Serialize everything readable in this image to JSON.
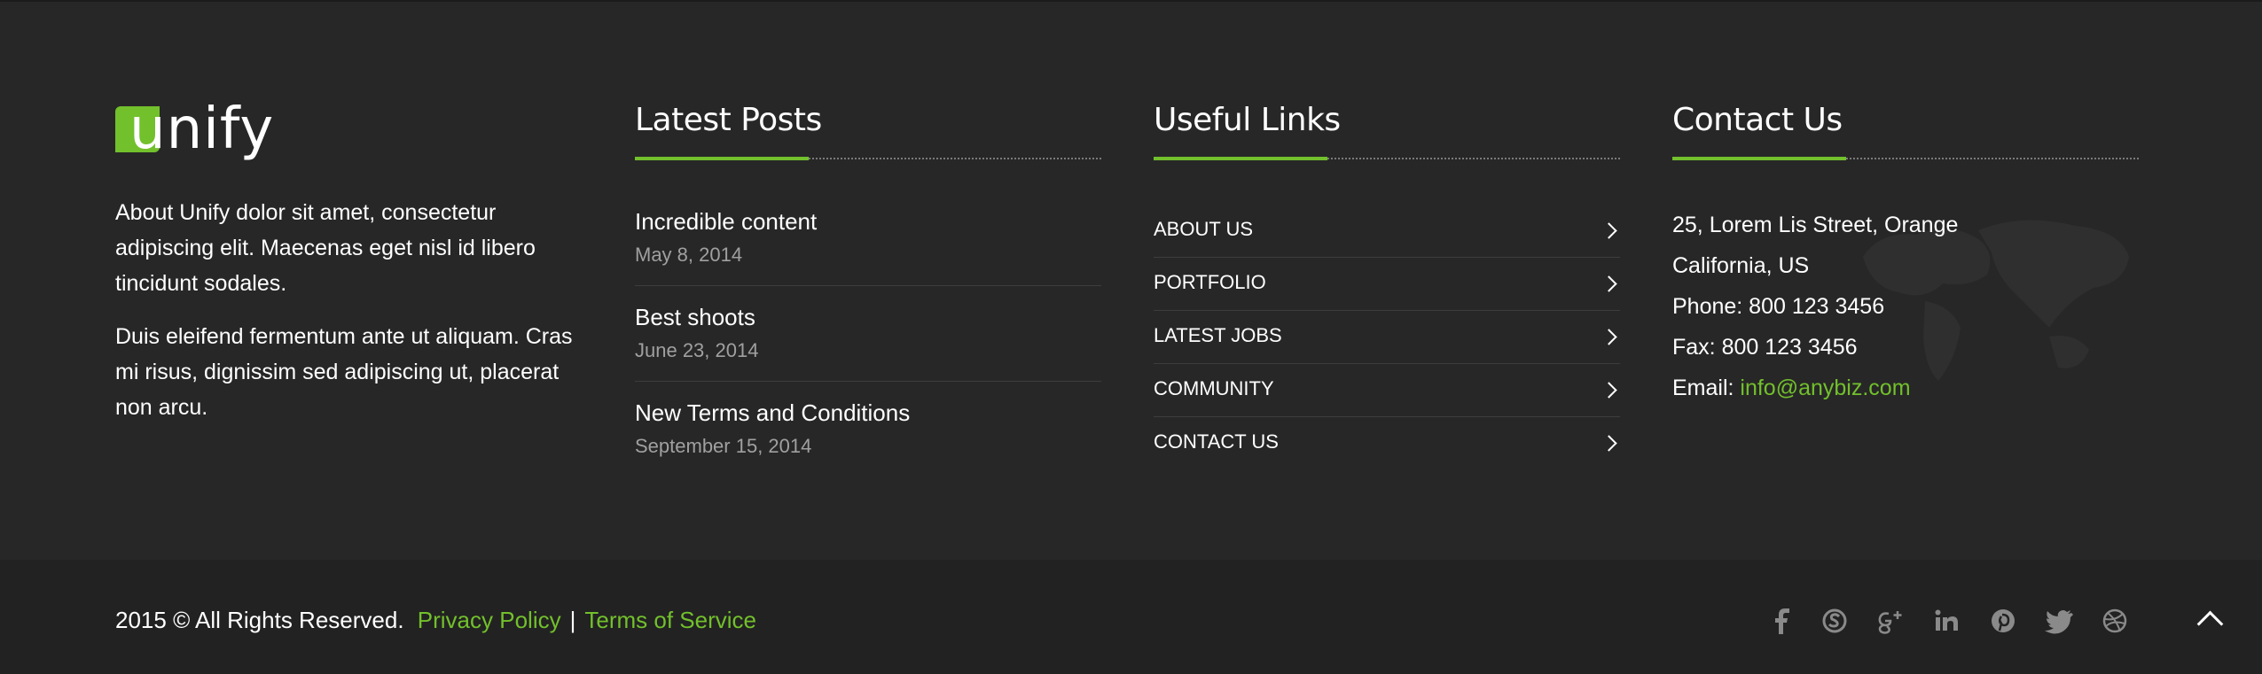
{
  "brand": {
    "logo_text": "unify",
    "accent_color": "#72c02c"
  },
  "about": {
    "paragraph_1": "About Unify dolor sit amet, consectetur adipiscing elit. Maecenas eget nisl id libero tincidunt sodales.",
    "paragraph_2": "Duis eleifend fermentum ante ut aliquam. Cras mi risus, dignissim sed adipiscing ut, placerat non arcu."
  },
  "latest_posts": {
    "heading": "Latest Posts",
    "items": [
      {
        "title": "Incredible content",
        "date": "May 8, 2014"
      },
      {
        "title": "Best shoots",
        "date": "June 23, 2014"
      },
      {
        "title": "New Terms and Conditions",
        "date": "September 15, 2014"
      }
    ]
  },
  "useful_links": {
    "heading": "Useful Links",
    "items": [
      {
        "label": "ABOUT US"
      },
      {
        "label": "PORTFOLIO"
      },
      {
        "label": "LATEST JOBS"
      },
      {
        "label": "COMMUNITY"
      },
      {
        "label": "CONTACT US"
      }
    ]
  },
  "contact": {
    "heading": "Contact Us",
    "address_line_1": "25, Lorem Lis Street, Orange",
    "address_line_2": "California, US",
    "phone": "Phone: 800 123 3456",
    "fax": "Fax: 800 123 3456",
    "email_label": "Email: ",
    "email": "info@anybiz.com"
  },
  "bottom_bar": {
    "copyright": "2015 © All Rights Reserved.",
    "privacy_policy": "Privacy Policy",
    "separator": "|",
    "terms_of_service": "Terms of Service",
    "social_icons": [
      "facebook-icon",
      "skype-icon",
      "google-plus-icon",
      "linkedin-icon",
      "pinterest-icon",
      "twitter-icon",
      "dribbble-icon"
    ],
    "social_icon_color": "#8a8a8a",
    "back_to_top_icon": "chevron-up-icon"
  }
}
